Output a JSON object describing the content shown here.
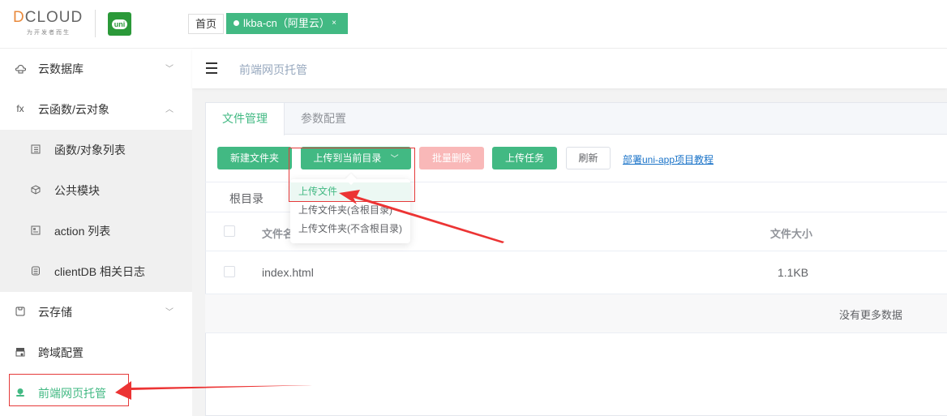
{
  "header": {
    "logo_text_first": "D",
    "logo_text_rest": "CLOUD",
    "logo_subtitle": "为开发者而生",
    "uni_label": "uni",
    "tabs": [
      {
        "label": "首页"
      },
      {
        "label": "lkba-cn（阿里云）",
        "close": "×"
      }
    ]
  },
  "sidebar": {
    "items": [
      {
        "label": "云数据库",
        "icon": "cloud-db-icon",
        "chevron": "﹀"
      },
      {
        "label": "云函数/云对象",
        "icon": "fx-icon",
        "icon_text": "fx",
        "chevron": "︿"
      },
      {
        "label": "函数/对象列表",
        "icon": "list-icon"
      },
      {
        "label": "公共模块",
        "icon": "cube-icon"
      },
      {
        "label": "action 列表",
        "icon": "action-list-icon"
      },
      {
        "label": "clientDB 相关日志",
        "icon": "log-icon"
      },
      {
        "label": "云存储",
        "icon": "storage-icon",
        "chevron": "﹀"
      },
      {
        "label": "跨域配置",
        "icon": "cors-icon"
      },
      {
        "label": "前端网页托管",
        "icon": "hosting-icon"
      }
    ]
  },
  "topbar": {
    "breadcrumb": "前端网页托管"
  },
  "content": {
    "tabs": [
      {
        "label": "文件管理"
      },
      {
        "label": "参数配置"
      }
    ],
    "buttons": {
      "new_folder": "新建文件夹",
      "upload": "上传到当前目录",
      "batch_delete": "批量删除",
      "upload_tasks": "上传任务",
      "refresh": "刷新"
    },
    "tutorial_link": "部署uni-app项目教程",
    "current_dir": "根目录",
    "dropdown": [
      {
        "label": "上传文件"
      },
      {
        "label": "上传文件夹(含根目录)"
      },
      {
        "label": "上传文件夹(不含根目录)"
      }
    ],
    "table": {
      "columns": [
        "文件名",
        "文件大小"
      ],
      "rows": [
        {
          "name": "index.html",
          "size": "1.1KB"
        }
      ],
      "no_more": "没有更多数据"
    }
  },
  "colors": {
    "accent": "#42b983",
    "danger_disabled": "#f9b8b8",
    "annotation": "#e53a3a",
    "link": "#1a73c8"
  }
}
